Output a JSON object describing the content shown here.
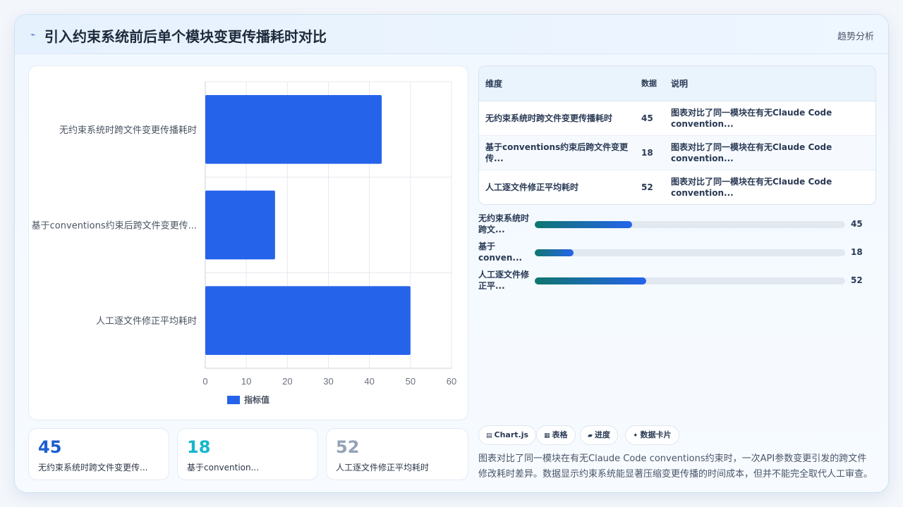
{
  "header": {
    "icon": "chart-line-icon",
    "title": "引入约束系统前后单个模块变更传播耗时对比",
    "link": "趋势分析"
  },
  "chart_data": {
    "type": "bar",
    "orientation": "horizontal",
    "categories": [
      "无约束系统时跨文件变更传播耗时",
      "基于conventions约束后跨文件变更传...",
      "人工逐文件修正平均耗时"
    ],
    "series": [
      {
        "name": "指标值",
        "values": [
          43,
          17,
          50
        ],
        "color": "#2563eb"
      }
    ],
    "xlim": [
      0,
      60
    ],
    "xticks": [
      0,
      10,
      20,
      30,
      40,
      50,
      60
    ],
    "grid": true,
    "legend": "bottom"
  },
  "stats": [
    {
      "value": "45",
      "label": "无约束系统时跨文件变更传...",
      "color": "#1d5fd1"
    },
    {
      "value": "18",
      "label": "基于convention...",
      "color": "#14b8c9"
    },
    {
      "value": "52",
      "label": "人工逐文件修正平均耗时",
      "color": "#94a3b8"
    }
  ],
  "table": {
    "headers": [
      "维度",
      "数据",
      "说明"
    ],
    "rows": [
      [
        "无约束系统时跨文件变更传播耗时",
        "45",
        "图表对比了同一模块在有无Claude Code convention..."
      ],
      [
        "基于conventions约束后跨文件变更传...",
        "18",
        "图表对比了同一模块在有无Claude Code convention..."
      ],
      [
        "人工逐文件修正平均耗时",
        "52",
        "图表对比了同一模块在有无Claude Code convention..."
      ]
    ]
  },
  "progress": [
    {
      "label": "无约束系统时跨文...",
      "value": 45,
      "display": "45",
      "fraction": 0.3125
    },
    {
      "label": "基于conven...",
      "value": 18,
      "display": "18",
      "fraction": 0.125
    },
    {
      "label": "人工逐文件修正平...",
      "value": 52,
      "display": "52",
      "fraction": 0.36
    }
  ],
  "tags": [
    {
      "icon": "chart-icon",
      "label": "Chart.js"
    },
    {
      "icon": "table-icon",
      "label": "表格"
    },
    {
      "icon": "progress-icon",
      "label": "进度"
    },
    {
      "icon": "sparkle-icon",
      "label": "数据卡片"
    }
  ],
  "description": "图表对比了同一模块在有无Claude Code conventions约束时，一次API参数变更引发的跨文件修改耗时差异。数据显示约束系统能显著压缩变更传播的时间成本，但并不能完全取代人工审查。"
}
